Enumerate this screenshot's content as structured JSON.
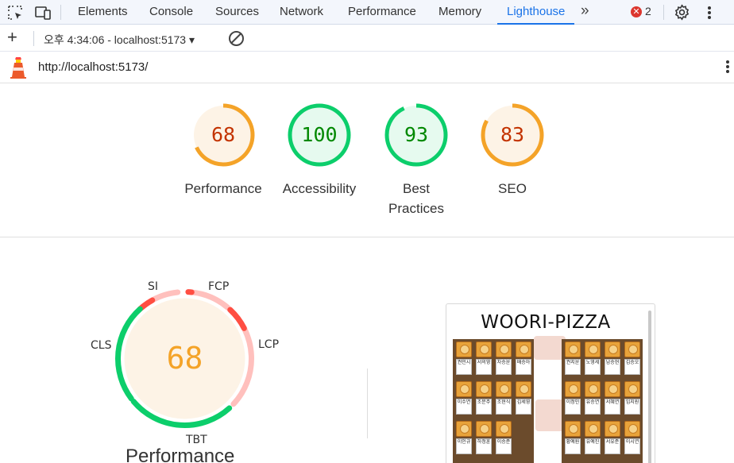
{
  "devtools": {
    "tabs": [
      {
        "label": "Elements"
      },
      {
        "label": "Console"
      },
      {
        "label": "Sources"
      },
      {
        "label": "Network"
      },
      {
        "label": "Performance"
      },
      {
        "label": "Memory"
      },
      {
        "label": "Lighthouse",
        "active": true
      }
    ],
    "more_tabs": "»",
    "error_count": "2",
    "error_glyph": "✕"
  },
  "toolbar": {
    "add_label": "+",
    "report_selector": "오후 4:34:06 - localhost:5173 ▾"
  },
  "report": {
    "url": "http://localhost:5173/"
  },
  "scores": [
    {
      "label": "Performance",
      "value": "68",
      "score": 0.68,
      "color": "#fa3"
    },
    {
      "label": "Accessibility",
      "value": "100",
      "score": 1.0,
      "color": "#0c6"
    },
    {
      "label": "Best Practices",
      "label_lines": [
        "Best",
        "Practices"
      ],
      "value": "93",
      "score": 0.93,
      "color": "#0c6"
    },
    {
      "label": "SEO",
      "value": "83",
      "score": 0.83,
      "color": "#fa3"
    }
  ],
  "performance_gauge": {
    "value": "68",
    "title": "Performance",
    "metrics": [
      "SI",
      "FCP",
      "LCP",
      "TBT",
      "CLS"
    ]
  },
  "screenshot": {
    "title": "WOORI-PIZZA",
    "left_names": [
      "권민시",
      "서의영",
      "차승윤",
      "배승아",
      "이수연",
      "조문주",
      "조현식",
      "김세영",
      "이인규",
      "하정훈",
      "이승준"
    ],
    "right_names": [
      "권지윤",
      "노영세",
      "남승현",
      "김승오",
      "이정민",
      "유승연",
      "서혜연",
      "임지원",
      "황예원",
      "유예진",
      "서유준",
      "이시연"
    ]
  },
  "colors": {
    "orange": "#f4a328",
    "orange_text": "#c33300",
    "green": "#0cce6b",
    "green_text": "#008800",
    "red": "#ff4e42",
    "accent": "#1a73e8"
  }
}
